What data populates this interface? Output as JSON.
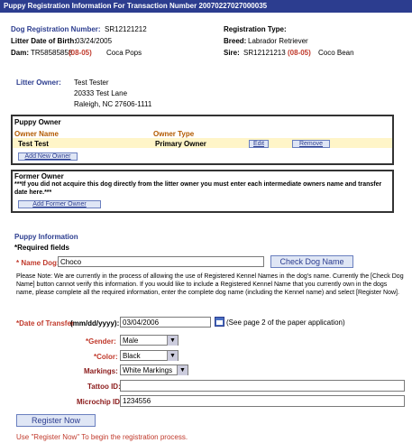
{
  "header": {
    "title": "Puppy Registration Information For Transaction Number 20070227027000035"
  },
  "dog_info": {
    "reg_number_label": "Dog Registration Number:",
    "reg_number_value": "SR12121212",
    "litter_dob_label": "Litter Date of Birth:",
    "litter_dob_value": "03/24/2005",
    "dam_label": "Dam:",
    "dam_number": "TR58585858",
    "dam_code": "(08-05)",
    "dam_name": "Coca Pops",
    "reg_type_label": "Registration Type:",
    "reg_type_value": "",
    "breed_label": "Breed:",
    "breed_value": "Labrador Retriever",
    "sire_label": "Sire:",
    "sire_number": "SR12121213",
    "sire_code": "(08-05)",
    "sire_name": "Coco Bean"
  },
  "litter_owner": {
    "label": "Litter Owner:",
    "name": "Test Tester",
    "address1": "20333 Test Lane",
    "address2": "Raleigh, NC 27606-1111"
  },
  "puppy_owner": {
    "section_title": "Puppy Owner",
    "col_name": "Owner Name",
    "col_type": "Owner Type",
    "row_name": "Test Test",
    "row_type": "Primary Owner",
    "edit_label": "Edit",
    "remove_label": "Remove",
    "add_label": "Add New Owner"
  },
  "former_owner": {
    "section_title": "Former Owner",
    "note": "***If you did not acquire this dog directly from the litter owner you must enter each intermediate owners name and transfer date here.***",
    "add_label": "Add Former Owner"
  },
  "puppy_info": {
    "section_title": "Puppy Information",
    "required_note": "*Required fields",
    "name_label": "* Name Dog:",
    "name_value": "Choco",
    "check_name_label": "Check Dog Name",
    "please_note": "Please Note: We are currently in the process of allowing the use of Registered Kennel Names in the dog's name. Currently the [Check Dog Name] button cannot verify this information. If you would like to include a Registered Kennel Name that you currently own in the dogs name, please complete all the required information, enter the complete dog name (including the Kennel name) and select [Register Now].",
    "transfer_label": "*Date of Transfer",
    "transfer_format": "(mm/dd/yyyy):",
    "transfer_value": "03/04/2006",
    "transfer_hint": "(See page 2 of the paper application)",
    "gender_label": "*Gender:",
    "gender_value": "Male",
    "color_label": "*Color:",
    "color_value": "Black",
    "markings_label": "Markings:",
    "markings_value": "White Markings",
    "tattoo_label": "Tattoo ID:",
    "tattoo_value": "",
    "microchip_label": "Microchip ID:",
    "microchip_value": "1234556",
    "register_label": "Register Now",
    "footer_note": "Use \"Register Now\" To begin the registration process."
  },
  "icons": {
    "calendar": "calendar-icon",
    "dropdown": "chevron-down-icon"
  },
  "colors": {
    "title_bar": "#2c3d8f",
    "accent_red": "#c0392b",
    "highlight_row": "#fff5c8"
  }
}
